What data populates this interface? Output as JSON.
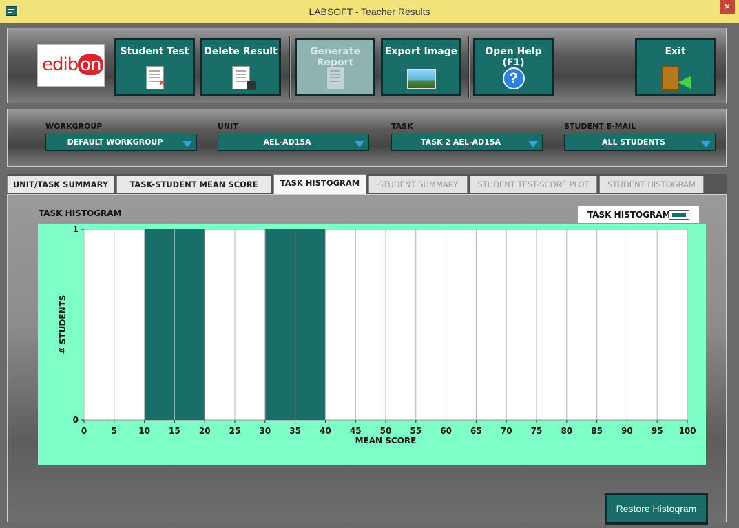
{
  "window": {
    "title": "LABSOFT - Teacher Results",
    "close": "×"
  },
  "logo": {
    "text_a": "edib",
    "text_b": "on"
  },
  "toolbar": {
    "student_test": "Student Test",
    "delete_result": "Delete Result",
    "generate_report": "Generate Report",
    "export_image": "Export Image",
    "open_help": "Open Help (F1)",
    "help_glyph": "?",
    "exit": "Exit"
  },
  "filters": {
    "workgroup": {
      "label": "WORKGROUP",
      "value": "DEFAULT WORKGROUP"
    },
    "unit": {
      "label": "UNIT",
      "value": "AEL-AD15A"
    },
    "task": {
      "label": "TASK",
      "value": "TASK 2 AEL-AD15A"
    },
    "email": {
      "label": "STUDENT E-MAIL",
      "value": "ALL STUDENTS"
    }
  },
  "tabs": {
    "unit_task_summary": "UNIT/TASK SUMMARY",
    "task_student_mean": "TASK-STUDENT MEAN SCORE PLOT",
    "task_histogram": "TASK HISTOGRAM",
    "student_summary": "STUDENT SUMMARY",
    "student_test_score": "STUDENT TEST-SCORE PLOT",
    "student_histogram": "STUDENT HISTOGRAM"
  },
  "panel": {
    "graph_title": "TASK HISTOGRAM",
    "legend_label": "TASK HISTOGRAM",
    "restore_button": "Restore Histogram"
  },
  "colors": {
    "accent": "#1a6e6a",
    "plot_bg": "#7effc7",
    "title_bar": "#f2e47a"
  },
  "chart_data": {
    "type": "bar",
    "title": "TASK HISTOGRAM",
    "xlabel": "MEAN SCORE",
    "ylabel": "# STUDENTS",
    "xlim": [
      0,
      100
    ],
    "ylim": [
      0,
      1
    ],
    "x_ticks": [
      "0",
      "5",
      "10",
      "15",
      "20",
      "25",
      "30",
      "35",
      "40",
      "45",
      "50",
      "55",
      "60",
      "65",
      "70",
      "75",
      "80",
      "85",
      "90",
      "95",
      "100"
    ],
    "y_ticks": [
      "0",
      "1"
    ],
    "bins": [
      {
        "from": 10,
        "to": 20,
        "value": 1
      },
      {
        "from": 30,
        "to": 40,
        "value": 1
      }
    ],
    "series": [
      {
        "name": "TASK HISTOGRAM"
      }
    ],
    "legend": "top-right",
    "grid": true
  }
}
